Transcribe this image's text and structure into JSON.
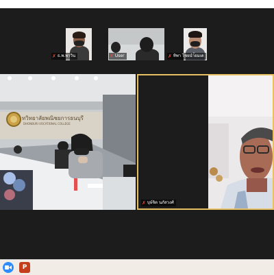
{
  "participants": [
    {
      "name": "ธ.พ.พาวิน",
      "muted": true
    },
    {
      "name": "User",
      "muted": true
    },
    {
      "name": "ทิพา ไชยนำ้อมเด",
      "muted": true
    }
  ],
  "room_tile": {
    "sign_text": "ทวิทยาลัยพณิชยการธนบุรี",
    "sign_sub": "DHONBURI VOCATIONAL COLLEGE"
  },
  "speaker_tile": {
    "name": "บุษ์จิต นภัสวงศ์",
    "muted": true
  },
  "taskbar": {
    "apps": [
      {
        "icon": "zoom-app-icon",
        "color": "#2d8cff"
      },
      {
        "icon": "powerpoint-app-icon",
        "color": "#c43e1c",
        "label": "P"
      }
    ]
  },
  "colors": {
    "active_speaker_border": "#e8c262",
    "meeting_background": "#1c1c1c",
    "mic_off": "#e74c3c"
  }
}
